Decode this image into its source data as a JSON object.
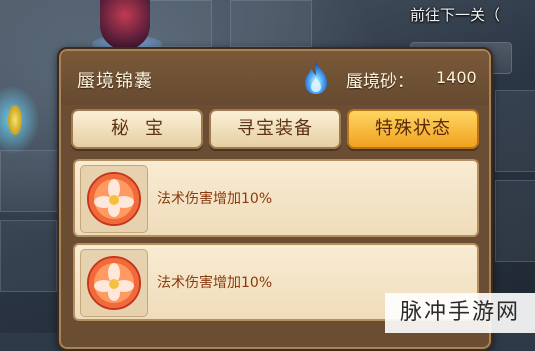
{
  "hud": {
    "hint_text": "前往下一关（"
  },
  "panel": {
    "title": "蜃境锦囊",
    "currency_label": "蜃境砂：",
    "currency_value": "1400",
    "currency_icon": "blue-flame-icon"
  },
  "tabs": [
    {
      "label": "秘宝",
      "active": false
    },
    {
      "label": "寻宝装备",
      "active": false
    },
    {
      "label": "特殊状态",
      "active": true
    }
  ],
  "items": [
    {
      "icon": "red-flower-orb-icon",
      "text": "法术伤害增加10%"
    },
    {
      "icon": "red-flower-orb-icon",
      "text": "法术伤害增加10%"
    }
  ],
  "watermark": "脉冲手游网",
  "colors": {
    "active_tab": "#f0a21f",
    "panel_bg": "#6b4d33",
    "item_text": "#8a3a10"
  }
}
